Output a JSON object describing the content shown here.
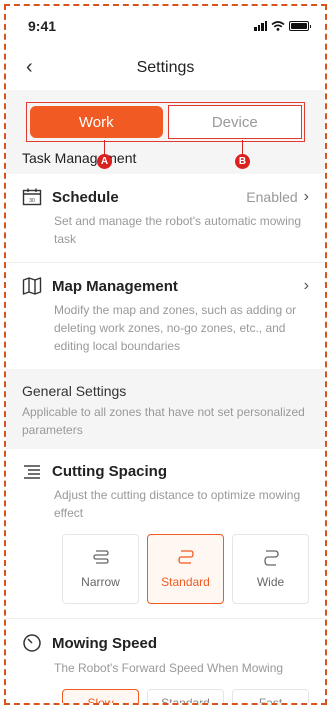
{
  "status": {
    "time": "9:41"
  },
  "nav": {
    "title": "Settings",
    "back_glyph": "‹"
  },
  "tabs": [
    {
      "label": "Work",
      "active": true
    },
    {
      "label": "Device",
      "active": false
    }
  ],
  "markers": {
    "a": "A",
    "b": "B"
  },
  "task_management": {
    "title": "Task Management",
    "items": [
      {
        "title": "Schedule",
        "value": "Enabled",
        "description": "Set and manage the robot's automatic mowing task",
        "icon": "calendar-icon"
      },
      {
        "title": "Map Management",
        "value": "",
        "description": "Modify the map and zones, such as adding or deleting work zones, no-go zones, etc., and editing local boundaries",
        "icon": "map-icon"
      }
    ]
  },
  "general_settings": {
    "title": "General Settings",
    "description": "Applicable to all zones that have not set personalized parameters"
  },
  "cutting_spacing": {
    "title": "Cutting Spacing",
    "description": "Adjust the cutting distance to optimize mowing effect",
    "options": [
      "Narrow",
      "Standard",
      "Wide"
    ],
    "selected": "Standard"
  },
  "mowing_speed": {
    "title": "Mowing Speed",
    "description": "The Robot's Forward Speed When Mowing",
    "options": [
      "Slow",
      "Standard",
      "Fast"
    ],
    "selected": "Slow"
  },
  "colors": {
    "accent": "#f25a23",
    "annotation": "#d9211f"
  }
}
